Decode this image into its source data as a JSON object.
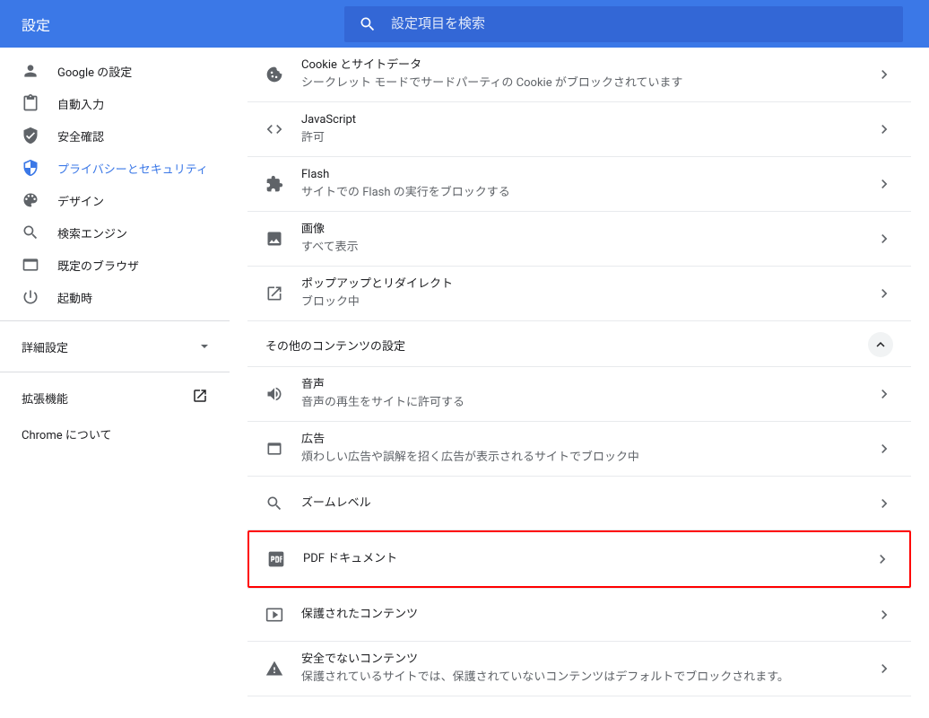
{
  "header": {
    "title": "設定",
    "search_placeholder": "設定項目を検索"
  },
  "sidebar": {
    "items": [
      {
        "label": "Google の設定",
        "icon": "person"
      },
      {
        "label": "自動入力",
        "icon": "clipboard"
      },
      {
        "label": "安全確認",
        "icon": "shield-check"
      },
      {
        "label": "プライバシーとセキュリティ",
        "icon": "shield",
        "active": true
      },
      {
        "label": "デザイン",
        "icon": "palette"
      },
      {
        "label": "検索エンジン",
        "icon": "magnify"
      },
      {
        "label": "既定のブラウザ",
        "icon": "browser"
      },
      {
        "label": "起動時",
        "icon": "power"
      }
    ],
    "advanced": "詳細設定",
    "extensions": "拡張機能",
    "about": "Chrome について"
  },
  "main": {
    "rows": [
      {
        "title": "Cookie とサイトデータ",
        "subtitle": "シークレット モードでサードパーティの Cookie がブロックされています",
        "icon": "cookie"
      },
      {
        "title": "JavaScript",
        "subtitle": "許可",
        "icon": "code"
      },
      {
        "title": "Flash",
        "subtitle": "サイトでの Flash の実行をブロックする",
        "icon": "plugin"
      },
      {
        "title": "画像",
        "subtitle": "すべて表示",
        "icon": "image"
      },
      {
        "title": "ポップアップとリダイレクト",
        "subtitle": "ブロック中",
        "icon": "popup"
      }
    ],
    "section_header": "その他のコンテンツの設定",
    "other_rows": [
      {
        "title": "音声",
        "subtitle": "音声の再生をサイトに許可する",
        "icon": "volume"
      },
      {
        "title": "広告",
        "subtitle": "煩わしい広告や誤解を招く広告が表示されるサイトでブロック中",
        "icon": "window"
      },
      {
        "title": "ズームレベル",
        "subtitle": "",
        "icon": "magnify"
      },
      {
        "title": "PDF ドキュメント",
        "subtitle": "",
        "icon": "pdf",
        "highlight": true
      },
      {
        "title": "保護されたコンテンツ",
        "subtitle": "",
        "icon": "protected"
      },
      {
        "title": "安全でないコンテンツ",
        "subtitle": "保護されているサイトでは、保護されていないコンテンツはデフォルトでブロックされます。",
        "icon": "warning"
      }
    ]
  }
}
